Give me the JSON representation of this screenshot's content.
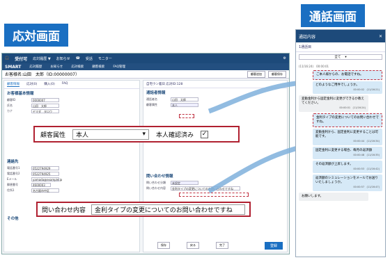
{
  "labels": {
    "reception": "応対画面",
    "call": "通話画面"
  },
  "topbar": {
    "app": "受付可",
    "items": [
      "応対履歴 ▼",
      "お知らせ"
    ],
    "icons": [
      "受話",
      "モニター"
    ]
  },
  "navbar": {
    "brand": "SMART",
    "items": [
      "応対履歴",
      "お知らせ",
      "応対検索",
      "顧客検索",
      "FAQ管理",
      "お知らせ"
    ]
  },
  "customer": {
    "title": "お客様名:山田　太郎（ID:00000007）",
    "btns": [
      "顧客追加",
      "顧客保存"
    ]
  },
  "left": {
    "tabs": [
      "顧客情報",
      "応対(0)",
      "購入(0)",
      "FAQ"
    ],
    "section1": "お客様基本情報",
    "rows": [
      {
        "lbl": "顧客ID",
        "val": "0000007"
      },
      {
        "lbl": "氏名",
        "val": "山田　太郎"
      },
      {
        "lbl": "カナ",
        "val": "ヤマダ　タロウ"
      }
    ],
    "section2": "連絡先",
    "contacts": [
      {
        "lbl": "電話番号1",
        "val": "0522794929"
      },
      {
        "lbl": "電話番号2",
        "val": "0522794925"
      },
      {
        "lbl": "Eメール",
        "val": "yamada@example.jp"
      }
    ],
    "address": [
      {
        "lbl": "郵便番号",
        "val": "4600003"
      },
      {
        "lbl": "住所1",
        "val": "名古屋市中区"
      }
    ],
    "section3": "その他"
  },
  "right": {
    "title": "自宅ウン着日 応対ID:128",
    "section1": "通話者情報",
    "rows": [
      {
        "lbl": "通話者名",
        "val": "山田　太郎"
      },
      {
        "lbl": "顧客属性",
        "val": "本人"
      }
    ],
    "section2": "問い合わせ情報",
    "inq": [
      {
        "lbl": "問い合わせ分類",
        "val": "未設定"
      },
      {
        "lbl": "問い合わせ内容",
        "val": "金利タイプの変更についてのお問い合わせですね"
      }
    ],
    "footer": [
      "保存",
      "戻る",
      "完了"
    ],
    "save": "登録"
  },
  "overlay1": {
    "label": "顧客属性",
    "value": "本人",
    "check_label": "本人確認済み",
    "checked": "✓"
  },
  "overlay2": {
    "label": "問い合わせ内容",
    "value": "金利タイプの変更についてのお問い合わせですね"
  },
  "chat": {
    "title": "通話内容",
    "tab": "1通話目",
    "filter": "全て",
    "messages": [
      {
        "who": "op",
        "text": "ご本人様からの、お電話ですね。",
        "time": "",
        "dash": true
      },
      {
        "who": "op",
        "text": "どのようなご用件でしょうか。",
        "time": "00:00:02　(11/16:21)",
        "dash": false
      },
      {
        "who": "cu",
        "text": "変動金利から固定金利に変更ができるか教えてください。",
        "time": "00:00:01　(11/16:24)",
        "dash": false
      },
      {
        "who": "op",
        "text": "金利タイプの変更についてのお問い合わせですね。",
        "time": "",
        "dash": true
      },
      {
        "who": "op",
        "text": "変動金利から、固定金利に変更することは可能です。",
        "time": "00:00:44　(11/16:34)",
        "dash": false
      },
      {
        "who": "op",
        "text": "固定金利に変更する場合、毎月の返済額",
        "time": "00:00:48　(11/16:35)",
        "dash": false
      },
      {
        "who": "op",
        "text": "その返済額が上昇します。",
        "time": "00:00:53　(11/16:42)",
        "dash": false
      },
      {
        "who": "op",
        "text": "返済額のシミュレーションをメールでお送りいたしましょうか。",
        "time": "00:00:57　(11/16:47)",
        "dash": false
      },
      {
        "who": "cu",
        "text": "お願いします。",
        "time": "",
        "dash": false
      }
    ]
  },
  "colors": {
    "brand": "#1a6fc2",
    "highlight": "#b02030"
  }
}
